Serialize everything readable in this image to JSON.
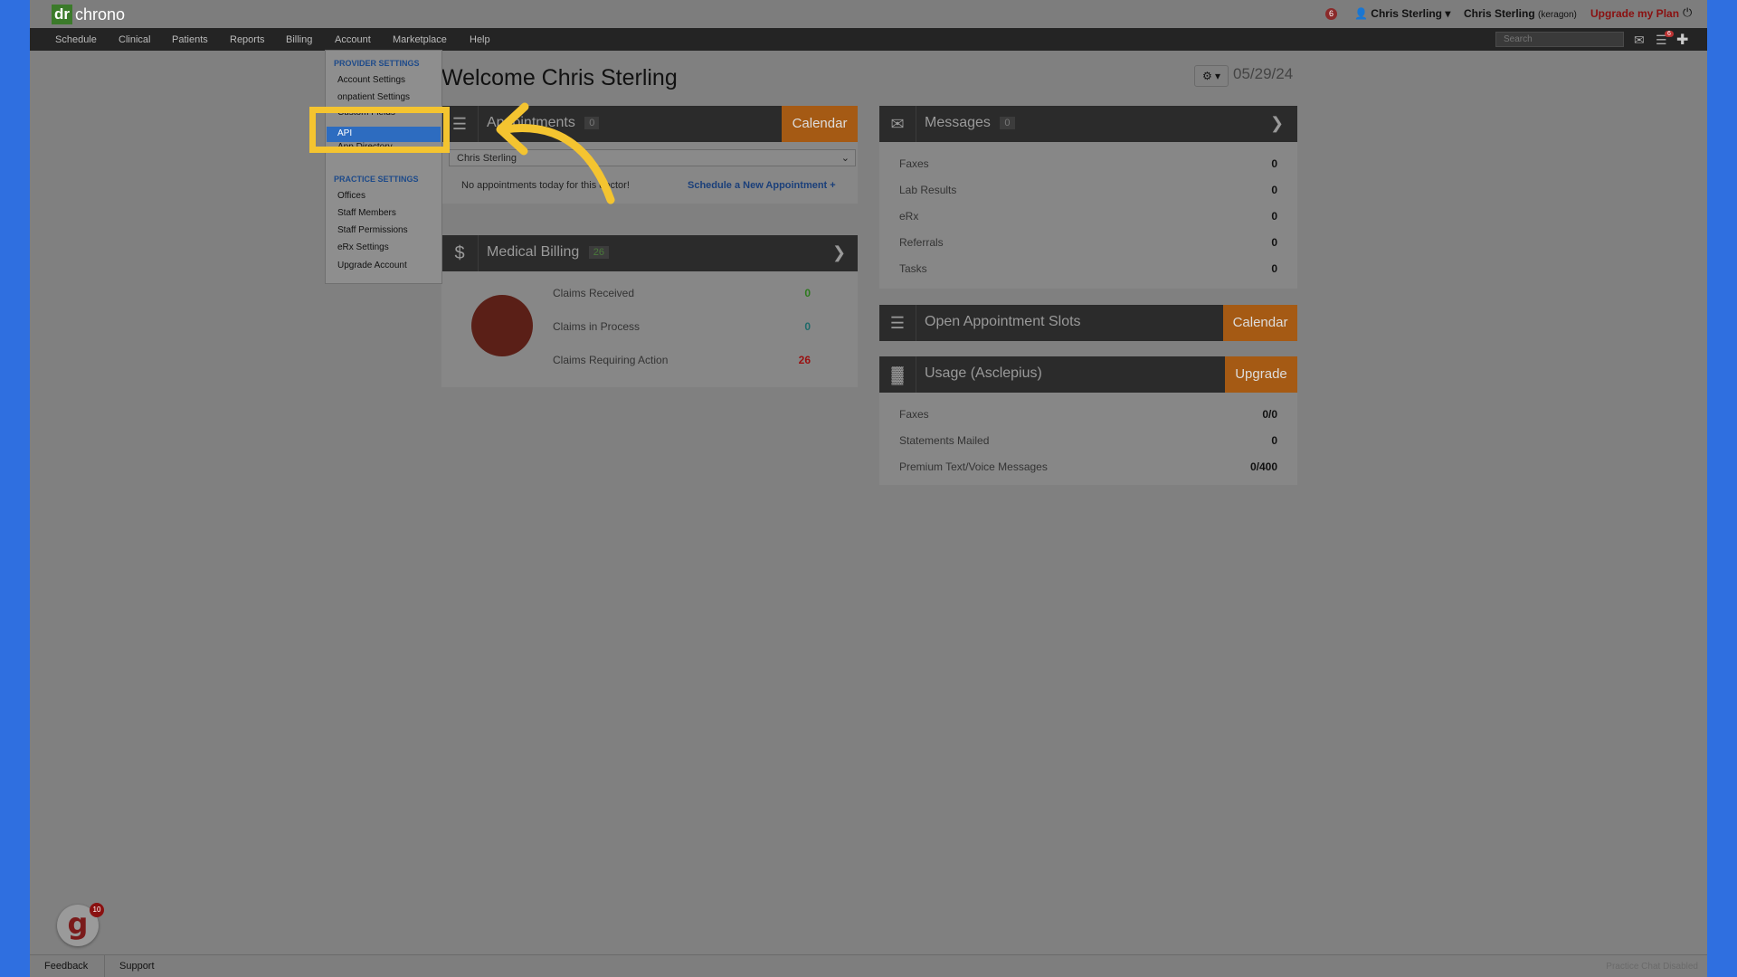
{
  "logo": {
    "dr": "dr",
    "chrono": "chrono"
  },
  "topbar": {
    "notif_count": "6",
    "user_menu": "Chris Sterling",
    "account_name": "Chris Sterling",
    "account_sub": "(keragon)",
    "upgrade": "Upgrade my Plan"
  },
  "nav": {
    "items": [
      "Schedule",
      "Clinical",
      "Patients",
      "Reports",
      "Billing",
      "Account",
      "Marketplace",
      "Help"
    ],
    "search_placeholder": "Search",
    "tasks_count": "6"
  },
  "dropdown": {
    "provider_header": "PROVIDER SETTINGS",
    "account_settings": "Account Settings",
    "onpatient_settings": "onpatient Settings",
    "custom_fields": "Custom Fields",
    "api": "API",
    "app_directory": "App Directory",
    "practice_header": "PRACTICE SETTINGS",
    "practice_items": [
      "Offices",
      "Staff Members",
      "Staff Permissions",
      "eRx Settings",
      "Upgrade Account"
    ]
  },
  "main": {
    "welcome": "Welcome Chris Sterling",
    "date": "05/29/24",
    "appointments": {
      "title": "Appointments",
      "count": "0",
      "calendar_btn": "Calendar",
      "doctor_select": "Chris Sterling",
      "empty_text": "No appointments today for this doctor!",
      "schedule_link": "Schedule a New Appointment +"
    },
    "billing": {
      "title": "Medical Billing",
      "count": "26",
      "claims": [
        {
          "label": "Claims Received",
          "value": "0",
          "color": "#2d7a1e"
        },
        {
          "label": "Claims in Process",
          "value": "0",
          "color": "#1f6a6a"
        },
        {
          "label": "Claims Requiring Action",
          "value": "26",
          "color": "#9a1010"
        }
      ]
    },
    "messages": {
      "title": "Messages",
      "count": "0",
      "rows": [
        {
          "label": "Faxes",
          "value": "0"
        },
        {
          "label": "Lab Results",
          "value": "0"
        },
        {
          "label": "eRx",
          "value": "0"
        },
        {
          "label": "Referrals",
          "value": "0"
        },
        {
          "label": "Tasks",
          "value": "0"
        }
      ]
    },
    "open_slots": {
      "title": "Open Appointment Slots",
      "calendar_btn": "Calendar"
    },
    "usage": {
      "title": "Usage (Asclepius)",
      "upgrade_btn": "Upgrade",
      "rows": [
        {
          "label": "Faxes",
          "value": "0/0"
        },
        {
          "label": "Statements Mailed",
          "value": "0"
        },
        {
          "label": "Premium Text/Voice Messages",
          "value": "0/400"
        }
      ]
    }
  },
  "footer": {
    "feedback": "Feedback",
    "support": "Support",
    "chat": "Practice Chat Disabled",
    "g_count": "10"
  },
  "colors": {
    "accent_orange": "#a55a14",
    "highlight_yellow": "#f4c430",
    "active_blue": "#2d6cc0"
  }
}
